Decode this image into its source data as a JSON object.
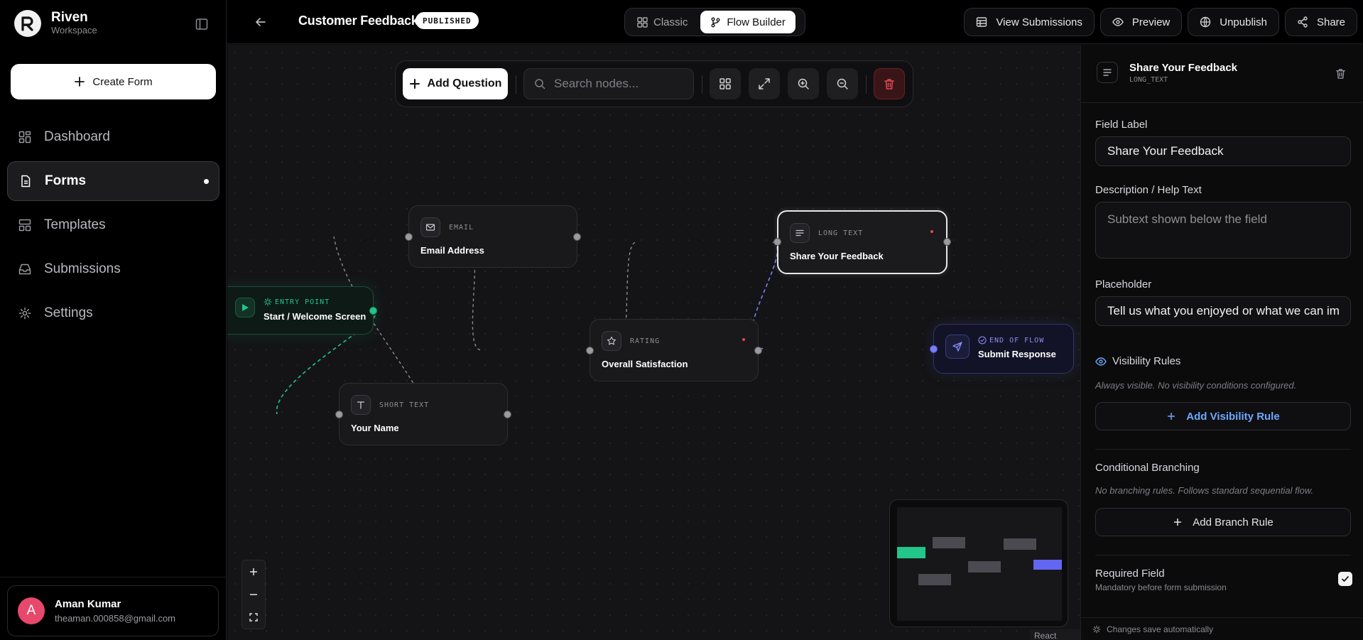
{
  "brand": {
    "name": "Riven",
    "sub": "Workspace"
  },
  "sidebar": {
    "create_label": "Create Form",
    "items": [
      {
        "label": "Dashboard"
      },
      {
        "label": "Forms"
      },
      {
        "label": "Templates"
      },
      {
        "label": "Submissions"
      },
      {
        "label": "Settings"
      }
    ],
    "user": {
      "initial": "A",
      "name": "Aman Kumar",
      "email": "theaman.000858@gmail.com"
    }
  },
  "topbar": {
    "title": "Customer Feedback",
    "status": "PUBLISHED",
    "modes": [
      {
        "label": "Classic"
      },
      {
        "label": "Flow Builder"
      }
    ],
    "actions": {
      "view_submissions": "View Submissions",
      "preview": "Preview",
      "unpublish": "Unpublish",
      "share": "Share"
    }
  },
  "toolbar": {
    "add_question": "Add Question",
    "search_placeholder": "Search nodes..."
  },
  "nodes": {
    "entry": {
      "type": "ENTRY POINT",
      "label": "Start / Welcome Screen"
    },
    "email": {
      "type": "EMAIL",
      "label": "Email Address"
    },
    "short": {
      "type": "SHORT TEXT",
      "label": "Your Name"
    },
    "rating": {
      "type": "RATING",
      "label": "Overall Satisfaction"
    },
    "long": {
      "type": "LONG TEXT",
      "label": "Share Your Feedback"
    },
    "end": {
      "type": "END OF FLOW",
      "label": "Submit Response"
    }
  },
  "canvas": {
    "attribution": "React Flow"
  },
  "panel": {
    "title": "Share Your Feedback",
    "type": "LONG_TEXT",
    "field_label_title": "Field Label",
    "field_label_value": "Share Your Feedback",
    "description_title": "Description / Help Text",
    "description_placeholder": "Subtext shown below the field",
    "placeholder_title": "Placeholder",
    "placeholder_value": "Tell us what you enjoyed or what we can im",
    "visibility_title": "Visibility Rules",
    "visibility_note": "Always visible. No visibility conditions configured.",
    "add_visibility": "Add Visibility Rule",
    "branching_title": "Conditional Branching",
    "branching_note": "No branching rules. Follows standard sequential flow.",
    "add_branch": "Add Branch Rule",
    "required_title": "Required Field",
    "required_note": "Mandatory before form submission",
    "save_note": "Changes save automatically"
  },
  "colors": {
    "accent_green": "#22c58a",
    "accent_indigo": "#6366f1",
    "danger": "#e24a55",
    "link_blue": "#6ea8ff"
  }
}
